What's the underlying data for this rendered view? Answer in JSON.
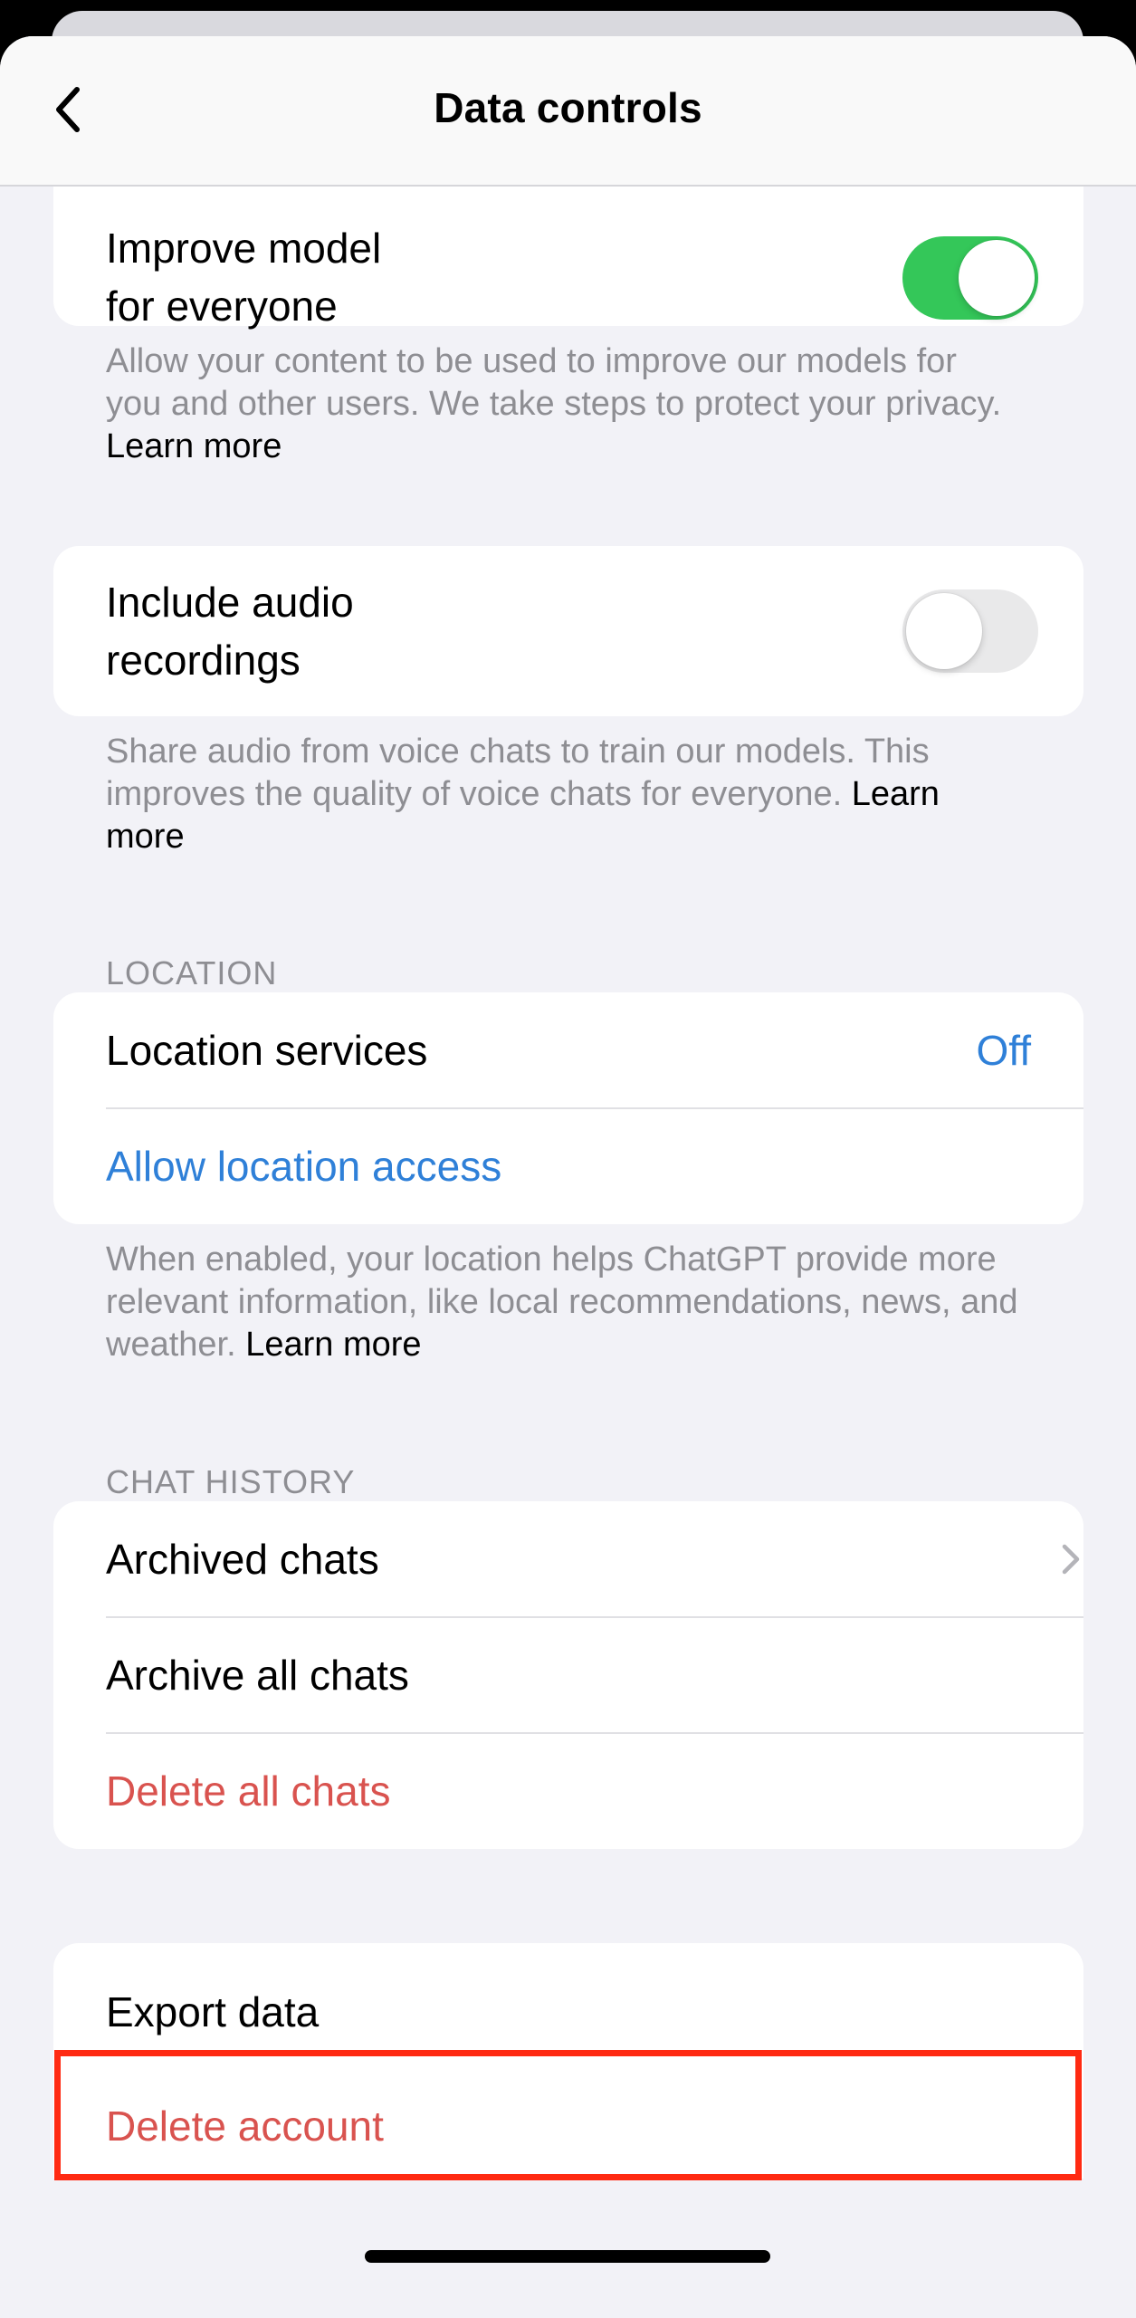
{
  "nav": {
    "title": "Data controls",
    "back_icon": "chevron-left-icon"
  },
  "improve_model": {
    "label_line1": "Improve model",
    "label_line2": "for everyone",
    "toggle_on": true,
    "footer_text": "Allow your content to be used to improve our models for you and other users. We take steps to protect your privacy. ",
    "footer_link": "Learn more"
  },
  "audio": {
    "label_line1": "Include audio",
    "label_line2": "recordings",
    "toggle_on": false,
    "footer_text": "Share audio from voice chats to train our models. This improves the quality of voice chats for everyone. ",
    "footer_link": "Learn more"
  },
  "location": {
    "header": "LOCATION",
    "services_label": "Location services",
    "services_value": "Off",
    "allow_label": "Allow location access",
    "footer_text": "When enabled, your location helps ChatGPT provide more relevant information, like local recommendations, news, and weather. ",
    "footer_link": "Learn more"
  },
  "chat_history": {
    "header": "CHAT HISTORY",
    "archived_label": "Archived chats",
    "archive_all_label": "Archive all chats",
    "delete_all_label": "Delete all chats",
    "chevron_icon": "chevron-right-icon"
  },
  "account": {
    "export_label": "Export data",
    "delete_label": "Delete account"
  },
  "colors": {
    "toggle_on": "#34c759",
    "link_blue": "#2f80d8",
    "destructive_red": "#d9534f",
    "highlight": "#ff2a12"
  }
}
